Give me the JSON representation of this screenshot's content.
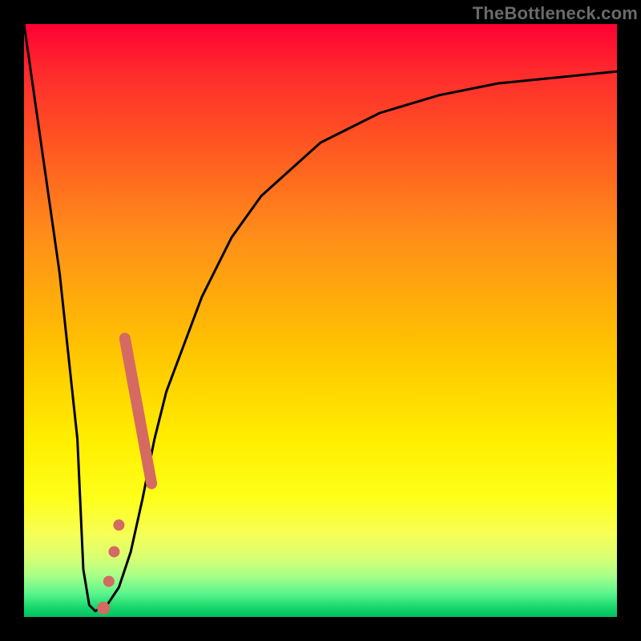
{
  "watermark": "TheBottleneck.com",
  "chart_data": {
    "type": "line",
    "title": "",
    "xlabel": "",
    "ylabel": "",
    "xlim": [
      0,
      100
    ],
    "ylim": [
      0,
      100
    ],
    "series": [
      {
        "name": "bottleneck-curve",
        "x": [
          0,
          3,
          6,
          9,
          10,
          11,
          12,
          14,
          16,
          18,
          20,
          22,
          24,
          27,
          30,
          35,
          40,
          50,
          60,
          70,
          80,
          90,
          100
        ],
        "y": [
          100,
          79,
          58,
          30,
          8,
          2,
          1,
          2,
          5,
          11,
          20,
          30,
          38,
          46,
          54,
          64,
          71,
          80,
          85,
          88,
          90,
          91,
          92
        ]
      }
    ],
    "markers": [
      {
        "name": "band-segment",
        "shape": "thick-line",
        "color": "#d46a62",
        "x0": 17.0,
        "y0": 47.0,
        "x1": 21.5,
        "y1": 22.5,
        "width": 14
      },
      {
        "name": "marker-dot",
        "shape": "circle",
        "color": "#d46a62",
        "x": 16.0,
        "y": 15.5,
        "r": 7
      },
      {
        "name": "marker-dot",
        "shape": "circle",
        "color": "#d46a62",
        "x": 15.2,
        "y": 11.0,
        "r": 7
      },
      {
        "name": "marker-dot",
        "shape": "circle",
        "color": "#d46a62",
        "x": 14.3,
        "y": 6.0,
        "r": 7
      },
      {
        "name": "marker-dot",
        "shape": "circle",
        "color": "#d46a62",
        "x": 13.4,
        "y": 1.5,
        "r": 8
      }
    ],
    "gradient_stops": [
      {
        "pos": 0.0,
        "color": "#ff0033"
      },
      {
        "pos": 0.55,
        "color": "#ffc400"
      },
      {
        "pos": 0.8,
        "color": "#feff1a"
      },
      {
        "pos": 1.0,
        "color": "#00c060"
      }
    ]
  }
}
